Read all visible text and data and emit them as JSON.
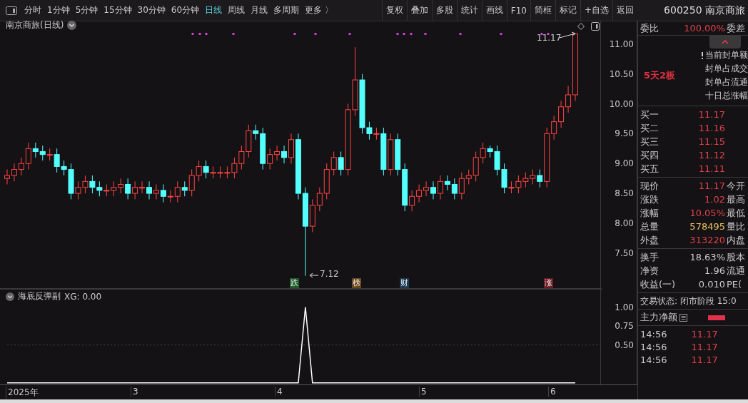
{
  "toolbar": {
    "periods": [
      {
        "label": "分时",
        "selected": false
      },
      {
        "label": "1分钟",
        "selected": false
      },
      {
        "label": "5分钟",
        "selected": false
      },
      {
        "label": "15分钟",
        "selected": false
      },
      {
        "label": "30分钟",
        "selected": false
      },
      {
        "label": "60分钟",
        "selected": false
      },
      {
        "label": "日线",
        "selected": true
      },
      {
        "label": "周线",
        "selected": false
      },
      {
        "label": "月线",
        "selected": false
      },
      {
        "label": "多周期",
        "selected": false
      },
      {
        "label": "更多 〉",
        "selected": false
      }
    ],
    "buttons": [
      "复权",
      "叠加",
      "多股",
      "统计",
      "画线",
      "F10",
      "简框",
      "标记",
      "+自选",
      "返回"
    ]
  },
  "quote_header": {
    "code": "600250",
    "name": "南京商旅"
  },
  "main_chart": {
    "title": "南京商旅(日线)",
    "high_label": "11.17",
    "low_label": "7.12",
    "event_tags": [
      {
        "text": "跌",
        "color": "#1d5a2a"
      },
      {
        "text": "榜",
        "color": "#6a4518"
      },
      {
        "text": "财",
        "color": "#1c3b55"
      },
      {
        "text": "涨",
        "color": "#6a1a22"
      }
    ],
    "chart_data": {
      "type": "candlestick",
      "ylim": [
        6.9,
        11.38
      ],
      "yticks": [
        {
          "value": 11,
          "label": "11.00"
        },
        {
          "value": 10.5,
          "label": "10.50"
        },
        {
          "value": 10,
          "label": "10.00"
        },
        {
          "value": 9.5,
          "label": "9.50"
        },
        {
          "value": 9,
          "label": "9.00"
        },
        {
          "value": 8.5,
          "label": "8.50"
        },
        {
          "value": 8,
          "label": "8.00"
        },
        {
          "value": 7.5,
          "label": "7.50"
        }
      ],
      "ohlc": [
        [
          8.75,
          8.9,
          8.65,
          8.8
        ],
        [
          8.8,
          9.0,
          8.7,
          8.9
        ],
        [
          8.9,
          9.1,
          8.8,
          9.0
        ],
        [
          9.0,
          9.35,
          8.9,
          9.25
        ],
        [
          9.25,
          9.35,
          9.1,
          9.2
        ],
        [
          9.2,
          9.3,
          9.05,
          9.15
        ],
        [
          9.15,
          9.25,
          9.05,
          9.15
        ],
        [
          9.15,
          9.25,
          8.85,
          8.95
        ],
        [
          8.95,
          9.05,
          8.8,
          8.9
        ],
        [
          8.9,
          9.0,
          8.4,
          8.5
        ],
        [
          8.5,
          8.7,
          8.4,
          8.6
        ],
        [
          8.6,
          8.8,
          8.5,
          8.7
        ],
        [
          8.7,
          8.8,
          8.5,
          8.6
        ],
        [
          8.6,
          8.7,
          8.45,
          8.55
        ],
        [
          8.55,
          8.65,
          8.45,
          8.55
        ],
        [
          8.55,
          8.7,
          8.45,
          8.6
        ],
        [
          8.6,
          8.75,
          8.5,
          8.65
        ],
        [
          8.65,
          8.75,
          8.4,
          8.5
        ],
        [
          8.5,
          8.7,
          8.4,
          8.6
        ],
        [
          8.6,
          8.7,
          8.5,
          8.6
        ],
        [
          8.6,
          8.7,
          8.4,
          8.5
        ],
        [
          8.5,
          8.65,
          8.4,
          8.55
        ],
        [
          8.55,
          8.65,
          8.35,
          8.45
        ],
        [
          8.45,
          8.55,
          8.35,
          8.45
        ],
        [
          8.45,
          8.7,
          8.35,
          8.6
        ],
        [
          8.6,
          8.7,
          8.45,
          8.55
        ],
        [
          8.55,
          8.9,
          8.45,
          8.8
        ],
        [
          8.8,
          9.05,
          8.7,
          8.95
        ],
        [
          8.95,
          9.05,
          8.75,
          8.85
        ],
        [
          8.85,
          8.95,
          8.75,
          8.85
        ],
        [
          8.85,
          8.95,
          8.75,
          8.85
        ],
        [
          8.85,
          8.95,
          8.75,
          8.85
        ],
        [
          8.85,
          9.1,
          8.75,
          9.0
        ],
        [
          9.0,
          9.3,
          8.9,
          9.2
        ],
        [
          9.2,
          9.65,
          9.1,
          9.55
        ],
        [
          9.55,
          9.65,
          9.4,
          9.5
        ],
        [
          9.5,
          9.6,
          8.9,
          9.0
        ],
        [
          9.0,
          9.25,
          8.9,
          9.15
        ],
        [
          9.15,
          9.3,
          9.05,
          9.2
        ],
        [
          9.2,
          9.3,
          9.0,
          9.1
        ],
        [
          9.1,
          9.5,
          9.0,
          9.4
        ],
        [
          9.4,
          9.5,
          8.4,
          8.5
        ],
        [
          8.5,
          8.6,
          7.12,
          7.95
        ],
        [
          7.95,
          8.4,
          7.85,
          8.3
        ],
        [
          8.3,
          8.6,
          8.2,
          8.5
        ],
        [
          8.5,
          9.0,
          8.4,
          8.9
        ],
        [
          8.9,
          9.2,
          8.8,
          9.1
        ],
        [
          9.1,
          9.2,
          8.8,
          8.9
        ],
        [
          8.9,
          10.0,
          8.8,
          9.9
        ],
        [
          9.9,
          10.95,
          9.8,
          10.4
        ],
        [
          10.4,
          10.5,
          9.5,
          9.6
        ],
        [
          9.6,
          9.7,
          9.4,
          9.5
        ],
        [
          9.5,
          9.6,
          9.4,
          9.5
        ],
        [
          9.5,
          9.6,
          8.8,
          8.9
        ],
        [
          8.9,
          9.5,
          8.8,
          9.4
        ],
        [
          9.4,
          9.5,
          8.8,
          8.9
        ],
        [
          8.9,
          9.0,
          8.2,
          8.3
        ],
        [
          8.3,
          8.55,
          8.2,
          8.45
        ],
        [
          8.45,
          8.65,
          8.35,
          8.55
        ],
        [
          8.55,
          8.7,
          8.45,
          8.6
        ],
        [
          8.6,
          8.7,
          8.4,
          8.5
        ],
        [
          8.5,
          8.8,
          8.4,
          8.7
        ],
        [
          8.7,
          8.8,
          8.55,
          8.65
        ],
        [
          8.65,
          8.75,
          8.4,
          8.5
        ],
        [
          8.5,
          8.85,
          8.4,
          8.75
        ],
        [
          8.75,
          8.9,
          8.65,
          8.8
        ],
        [
          8.8,
          9.2,
          8.7,
          9.1
        ],
        [
          9.1,
          9.35,
          9.0,
          9.25
        ],
        [
          9.25,
          9.3,
          9.1,
          9.2
        ],
        [
          9.2,
          9.3,
          8.8,
          8.9
        ],
        [
          8.9,
          9.0,
          8.5,
          8.6
        ],
        [
          8.6,
          8.7,
          8.5,
          8.6
        ],
        [
          8.6,
          8.8,
          8.5,
          8.7
        ],
        [
          8.7,
          8.85,
          8.6,
          8.75
        ],
        [
          8.75,
          8.9,
          8.65,
          8.8
        ],
        [
          8.8,
          8.9,
          8.6,
          8.7
        ],
        [
          8.7,
          9.6,
          8.6,
          9.5
        ],
        [
          9.5,
          9.8,
          9.4,
          9.7
        ],
        [
          9.7,
          10.05,
          9.6,
          9.95
        ],
        [
          9.95,
          10.3,
          9.85,
          10.15
        ],
        [
          10.15,
          11.17,
          10.05,
          11.17
        ]
      ]
    }
  },
  "indicator": {
    "title": "海底反弹副",
    "reading": ": 0.00",
    "chart_data": {
      "type": "line",
      "ylim": [
        -0.03,
        1.24
      ],
      "yticks": [
        {
          "value": 1,
          "label": "1.00"
        },
        {
          "value": 0.75,
          "label": "0.75"
        },
        {
          "value": 0.5,
          "label": "0.50"
        }
      ],
      "series": [
        {
          "name": "XG",
          "color": "#ffffff",
          "values": [
            0,
            0,
            0,
            0,
            0,
            0,
            0,
            0,
            0,
            0,
            0,
            0,
            0,
            0,
            0,
            0,
            0,
            0,
            0,
            0,
            0,
            0,
            0,
            0,
            0,
            0,
            0,
            0,
            0,
            0,
            0,
            0,
            0,
            0,
            0,
            0,
            0,
            0,
            0,
            0,
            0,
            0,
            1,
            0,
            0,
            0,
            0,
            0,
            0,
            0,
            0,
            0,
            0,
            0,
            0,
            0,
            0,
            0,
            0,
            0,
            0,
            0,
            0,
            0,
            0,
            0,
            0,
            0,
            0,
            0,
            0,
            0,
            0,
            0,
            0,
            0,
            0,
            0,
            0,
            0,
            0
          ]
        }
      ]
    }
  },
  "time_axis": [
    "2025年",
    "3",
    "4",
    "5",
    "6"
  ],
  "panel": {
    "ratio_row": {
      "label": "委比",
      "value": "100.00%",
      "next_label": "委差"
    },
    "board_badge": "5天2板",
    "seal_items": [
      {
        "text": "当前封单额",
        "flagged": true
      },
      {
        "text": "封单占成交",
        "flagged": false
      },
      {
        "text": "封单占流通",
        "flagged": false
      },
      {
        "text": "十日总涨幅",
        "flagged": false
      }
    ],
    "bids": [
      {
        "label": "买一",
        "price": "11.17"
      },
      {
        "label": "买二",
        "price": "11.16"
      },
      {
        "label": "买三",
        "price": "11.15"
      },
      {
        "label": "买四",
        "price": "11.12"
      },
      {
        "label": "买五",
        "price": "11.11"
      }
    ],
    "quotes": [
      {
        "label": "现价",
        "value": "11.17",
        "color": "#e0404a",
        "next_label": "今开"
      },
      {
        "label": "涨跌",
        "value": "1.02",
        "color": "#e0404a",
        "next_label": "最高"
      },
      {
        "label": "涨幅",
        "value": "10.05%",
        "color": "#e0404a",
        "next_label": "最低"
      },
      {
        "label": "总量",
        "value": "578495",
        "color": "#e8c060",
        "next_label": "量比"
      },
      {
        "label": "外盘",
        "value": "313220",
        "color": "#e0404a",
        "next_label": "内盘"
      }
    ],
    "stats": [
      {
        "label": "换手",
        "value": "18.63%",
        "next_label": "股本"
      },
      {
        "label": "净资",
        "value": "1.96",
        "next_label": "流通"
      },
      {
        "label": "收益(一)",
        "value": "0.010",
        "next_label": "PE("
      }
    ],
    "trade_status": "交易状态: 闭市阶段 15:0",
    "net_flow_label": "主力净额",
    "ticks": [
      {
        "time": "14:56",
        "price": "11.17"
      },
      {
        "time": "14:56",
        "price": "11.17"
      },
      {
        "time": "14:56",
        "price": "11.17"
      }
    ]
  }
}
